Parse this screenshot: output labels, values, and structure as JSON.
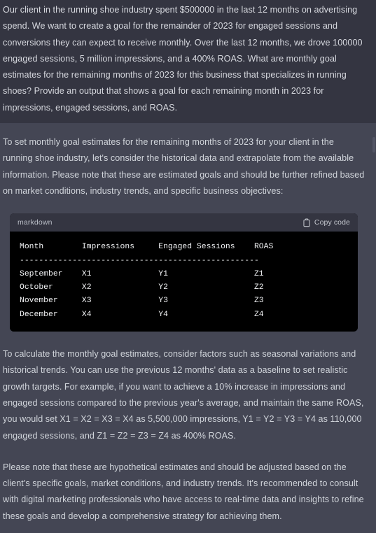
{
  "conversation": {
    "user_message": {
      "role": "user",
      "text": "Our client in the running shoe industry spent $500000 in the last 12 months on advertising spend. We want to create a goal for the remainder of 2023 for engaged sessions and conversions they can expect to receive monthly. Over the last 12 months, we drove 100000 engaged sessions, 5 million impressions, and a 400% ROAS. What are monthly goal estimates for the remaining months of 2023 for this business that specializes in running shoes? Provide an output that shows a goal for each remaining month in 2023 for impressions, engaged sessions, and ROAS."
    },
    "assistant_message": {
      "role": "assistant",
      "paragraph_1": "To set monthly goal estimates for the remaining months of 2023 for your client in the running shoe industry, let's consider the historical data and extrapolate from the available information. Please note that these are estimated goals and should be further refined based on market conditions, industry trends, and specific business objectives:",
      "paragraph_2": "To calculate the monthly goal estimates, consider factors such as seasonal variations and historical trends. You can use the previous 12 months' data as a baseline to set realistic growth targets. For example, if you want to achieve a 10% increase in impressions and engaged sessions compared to the previous year's average, and maintain the same ROAS, you would set X1 = X2 = X3 = X4 as 5,500,000 impressions, Y1 = Y2 = Y3 = Y4 as 110,000 engaged sessions, and Z1 = Z2 = Z3 = Z4 as 400% ROAS.",
      "paragraph_3": "Please note that these are hypothetical estimates and should be adjusted based on the client's specific goals, market conditions, and industry trends. It's recommended to consult with digital marketing professionals who have access to real-time data and insights to refine these goals and develop a comprehensive strategy for achieving them."
    },
    "code_block": {
      "language_label": "markdown",
      "copy_label": "Copy code",
      "copy_icon": "clipboard-icon",
      "columns": [
        "Month",
        "Impressions",
        "Engaged Sessions",
        "ROAS"
      ],
      "separator": "--------------------------------------------------",
      "rows": [
        [
          "September",
          "X1",
          "Y1",
          "Z1"
        ],
        [
          "October",
          "X2",
          "Y2",
          "Z2"
        ],
        [
          "November",
          "X3",
          "Y3",
          "Z3"
        ],
        [
          "December",
          "X4",
          "Y4",
          "Z4"
        ]
      ],
      "raw_text": "Month        Impressions     Engaged Sessions    ROAS\n--------------------------------------------------\nSeptember    X1              Y1                  Z1\nOctober      X2              Y2                  Z2\nNovember     X3              Y3                  Z3\nDecember     X4              Y4                  Z4"
    }
  },
  "colors": {
    "user_background": "#343541",
    "assistant_background": "#444654",
    "code_background": "#000000",
    "code_header_background": "#343541",
    "body_text": "#d1d5db",
    "scrollbar_thumb": "#565869"
  }
}
